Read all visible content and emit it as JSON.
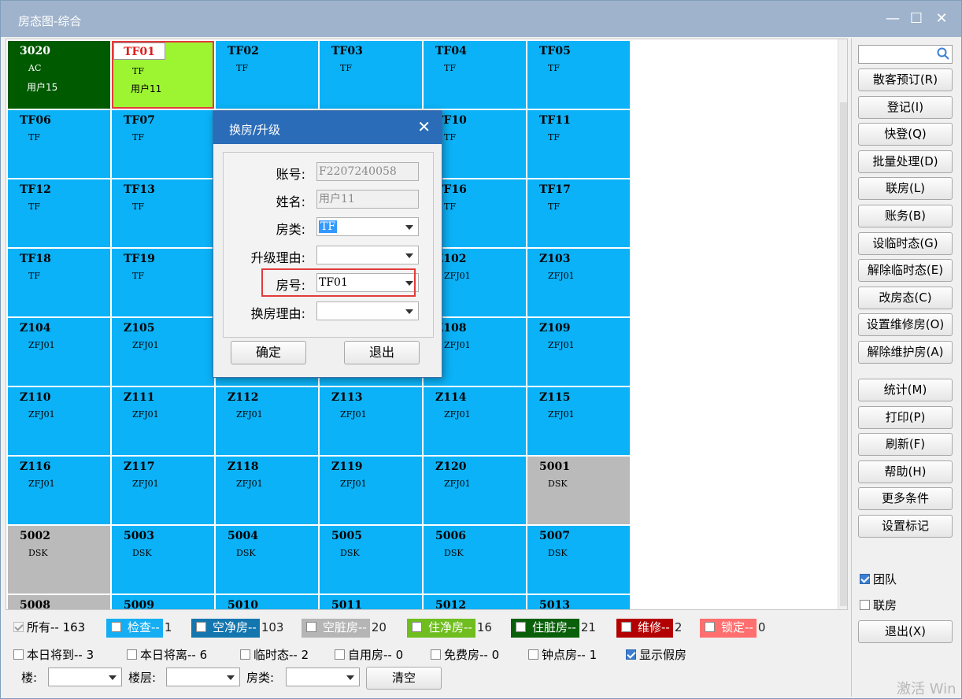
{
  "window": {
    "title": "房态图-综合",
    "minimize": "—",
    "maximize": "☐",
    "close": "✕"
  },
  "colors": {
    "clean": "#0bb2f7",
    "green": "#9df532",
    "dark_green": "#005a00",
    "gray": "#bababa",
    "check": "#16aef3",
    "empty_clean": "#1476ae",
    "empty_dirty": "#b5b5b5",
    "occupied_clean": "#6fbd1f",
    "occupied_dirty": "#0a5f0a",
    "repair": "#b30000",
    "locked": "#ff6f6f"
  },
  "rooms": [
    {
      "num": "3020",
      "type": "AC",
      "user": "用户15",
      "color": "dark_green",
      "white": false
    },
    {
      "num": "TF01",
      "type": "TF",
      "user": "用户11",
      "color": "green",
      "highlight": true
    },
    {
      "num": "TF02",
      "type": "TF",
      "color": "clean"
    },
    {
      "num": "TF03",
      "type": "TF",
      "color": "clean"
    },
    {
      "num": "TF04",
      "type": "TF",
      "color": "clean"
    },
    {
      "num": "TF05",
      "type": "TF",
      "color": "clean"
    },
    {
      "num": "TF06",
      "type": "TF",
      "color": "clean"
    },
    {
      "num": "TF07",
      "type": "TF",
      "color": "clean"
    },
    {
      "num": "",
      "type": "",
      "color": "clean"
    },
    {
      "num": "",
      "type": "",
      "color": "clean"
    },
    {
      "num": "TF10",
      "type": "TF",
      "color": "clean"
    },
    {
      "num": "TF11",
      "type": "TF",
      "color": "clean"
    },
    {
      "num": "TF12",
      "type": "TF",
      "color": "clean"
    },
    {
      "num": "TF13",
      "type": "TF",
      "color": "clean"
    },
    {
      "num": "",
      "type": "",
      "color": "clean"
    },
    {
      "num": "",
      "type": "",
      "color": "clean"
    },
    {
      "num": "TF16",
      "type": "TF",
      "color": "clean"
    },
    {
      "num": "TF17",
      "type": "TF",
      "color": "clean"
    },
    {
      "num": "TF18",
      "type": "TF",
      "color": "clean"
    },
    {
      "num": "TF19",
      "type": "TF",
      "color": "clean"
    },
    {
      "num": "",
      "type": "",
      "color": "clean"
    },
    {
      "num": "",
      "type": "",
      "color": "clean"
    },
    {
      "num": "Z102",
      "type": "ZFJ01",
      "color": "clean"
    },
    {
      "num": "Z103",
      "type": "ZFJ01",
      "color": "clean"
    },
    {
      "num": "Z104",
      "type": "ZFJ01",
      "color": "clean"
    },
    {
      "num": "Z105",
      "type": "ZFJ01",
      "color": "clean"
    },
    {
      "num": "",
      "type": "",
      "color": "clean"
    },
    {
      "num": "",
      "type": "",
      "color": "clean"
    },
    {
      "num": "Z108",
      "type": "ZFJ01",
      "color": "clean"
    },
    {
      "num": "Z109",
      "type": "ZFJ01",
      "color": "clean"
    },
    {
      "num": "Z110",
      "type": "ZFJ01",
      "color": "clean"
    },
    {
      "num": "Z111",
      "type": "ZFJ01",
      "color": "clean"
    },
    {
      "num": "Z112",
      "type": "ZFJ01",
      "color": "clean"
    },
    {
      "num": "Z113",
      "type": "ZFJ01",
      "color": "clean"
    },
    {
      "num": "Z114",
      "type": "ZFJ01",
      "color": "clean"
    },
    {
      "num": "Z115",
      "type": "ZFJ01",
      "color": "clean"
    },
    {
      "num": "Z116",
      "type": "ZFJ01",
      "color": "clean"
    },
    {
      "num": "Z117",
      "type": "ZFJ01",
      "color": "clean"
    },
    {
      "num": "Z118",
      "type": "ZFJ01",
      "color": "clean"
    },
    {
      "num": "Z119",
      "type": "ZFJ01",
      "color": "clean"
    },
    {
      "num": "Z120",
      "type": "ZFJ01",
      "color": "clean"
    },
    {
      "num": "5001",
      "type": "DSK",
      "color": "gray"
    },
    {
      "num": "5002",
      "type": "DSK",
      "color": "gray"
    },
    {
      "num": "5003",
      "type": "DSK",
      "color": "clean"
    },
    {
      "num": "5004",
      "type": "DSK",
      "color": "clean"
    },
    {
      "num": "5005",
      "type": "DSK",
      "color": "clean"
    },
    {
      "num": "5006",
      "type": "DSK",
      "color": "clean"
    },
    {
      "num": "5007",
      "type": "DSK",
      "color": "clean"
    },
    {
      "num": "5008",
      "type": "",
      "color": "gray"
    },
    {
      "num": "5009",
      "type": "",
      "color": "clean"
    },
    {
      "num": "5010",
      "type": "",
      "color": "clean"
    },
    {
      "num": "5011",
      "type": "",
      "color": "clean"
    },
    {
      "num": "5012",
      "type": "",
      "color": "clean"
    },
    {
      "num": "5013",
      "type": "",
      "color": "clean"
    }
  ],
  "sidebar": {
    "search_placeholder": "",
    "buttons": [
      "散客预订(R)",
      "登记(I)",
      "快登(Q)",
      "批量处理(D)",
      "联房(L)",
      "账务(B)",
      "设临时态(G)",
      "解除临时态(E)",
      "改房态(C)",
      "设置维修房(O)",
      "解除维护房(A)"
    ],
    "buttons2": [
      "统计(M)",
      "打印(P)",
      "刷新(F)",
      "帮助(H)",
      "更多条件",
      "设置标记"
    ],
    "team_label": "团队",
    "team_checked": true,
    "link_label": "联房",
    "link_checked": false,
    "exit": "退出(X)"
  },
  "legend": {
    "all": "所有-- 163",
    "items": [
      {
        "label": "检查--",
        "count": "1",
        "color": "check"
      },
      {
        "label": "空净房--",
        "count": "103",
        "color": "empty_clean"
      },
      {
        "label": "空脏房--",
        "count": "20",
        "color": "empty_dirty"
      },
      {
        "label": "住净房--",
        "count": "16",
        "color": "occupied_clean"
      },
      {
        "label": "住脏房--",
        "count": "21",
        "color": "occupied_dirty"
      },
      {
        "label": "维修--",
        "count": "2",
        "color": "repair"
      },
      {
        "label": "锁定--",
        "count": "0",
        "color": "locked"
      }
    ]
  },
  "filters": {
    "items": [
      {
        "label": "本日将到-- 3",
        "checked": false
      },
      {
        "label": "本日将离-- 6",
        "checked": false
      },
      {
        "label": "临时态-- 2",
        "checked": false
      },
      {
        "label": "自用房-- 0",
        "checked": false
      },
      {
        "label": "免费房-- 0",
        "checked": false
      },
      {
        "label": "钟点房-- 1",
        "checked": false
      },
      {
        "label": "显示假房",
        "checked": true
      }
    ],
    "building_label": "楼:",
    "floor_label": "楼层:",
    "roomtype_label": "房类:",
    "clear": "清空"
  },
  "dialog": {
    "title": "换房/升级",
    "close": "✕",
    "account_label": "账号:",
    "account_value": "F2207240058",
    "name_label": "姓名:",
    "name_value": "用户11",
    "roomtype_label": "房类:",
    "roomtype_value": "TF",
    "upgrade_reason_label": "升级理由:",
    "upgrade_reason_value": "",
    "room_label": "房号:",
    "room_value": "TF01",
    "change_reason_label": "换房理由:",
    "change_reason_value": "",
    "ok": "确定",
    "exit": "退出"
  },
  "watermark": "激活 Win"
}
